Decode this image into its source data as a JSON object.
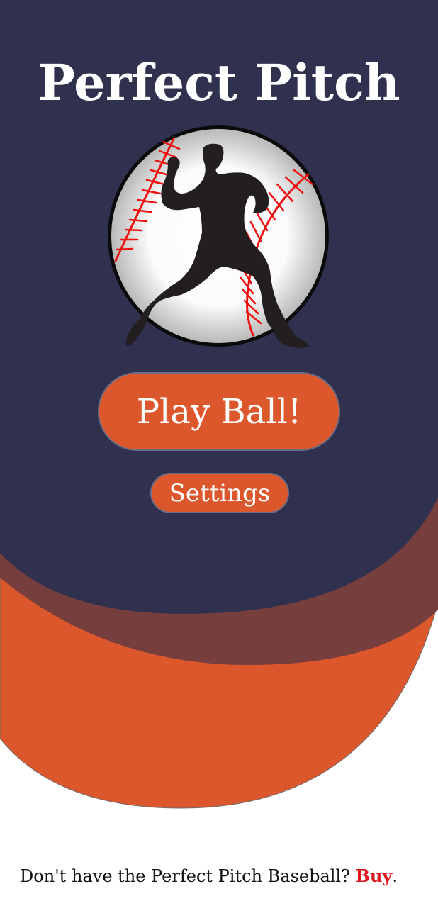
{
  "app": {
    "title": "Perfect Pitch"
  },
  "logo": {
    "icon": "pitcher-baseball-logo-icon"
  },
  "buttons": {
    "play_label": "Play Ball!",
    "settings_label": "Settings"
  },
  "footer": {
    "text": "Don't have the Perfect Pitch Baseball?",
    "link_label": "Buy",
    "period": "."
  },
  "colors": {
    "navy": "#30304f",
    "orange": "#dd572d",
    "maroon": "#773e3e",
    "link_red": "#e0141e",
    "seam_red": "#ee1111"
  }
}
